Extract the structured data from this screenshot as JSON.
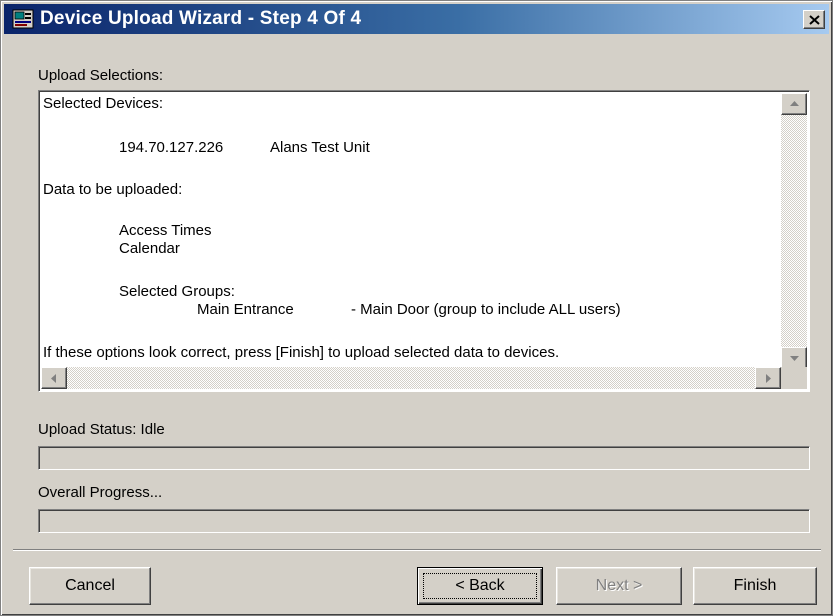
{
  "window": {
    "title": "Device Upload Wizard - Step 4 Of 4"
  },
  "icons": {
    "app": "wizard-app-icon",
    "close": "close-icon",
    "scroll_up": "arrow-up-icon",
    "scroll_down": "arrow-down-icon",
    "scroll_left": "arrow-left-icon",
    "scroll_right": "arrow-right-icon"
  },
  "upload_selections": {
    "label": "Upload Selections:",
    "selected_devices_label": "Selected Devices:",
    "device": {
      "ip": "194.70.127.226",
      "name": "Alans Test Unit"
    },
    "data_label": "Data to be uploaded:",
    "data_items": [
      "Access Times",
      "Calendar"
    ],
    "groups_label": "Selected Groups:",
    "group": {
      "name": "Main Entrance",
      "description": "- Main Door (group to include ALL users)"
    },
    "instruction": "If these options look correct, press [Finish] to upload selected data to devices."
  },
  "upload_status": {
    "label": "Upload Status: Idle",
    "progress": 0
  },
  "overall_progress": {
    "label": "Overall Progress...",
    "progress": 0
  },
  "buttons": {
    "cancel": "Cancel",
    "back": "< Back",
    "next": "Next >",
    "finish": "Finish"
  },
  "colors": {
    "titlebar_start": "#0a246a",
    "titlebar_end": "#a6caf0",
    "face": "#d4d0c8"
  }
}
